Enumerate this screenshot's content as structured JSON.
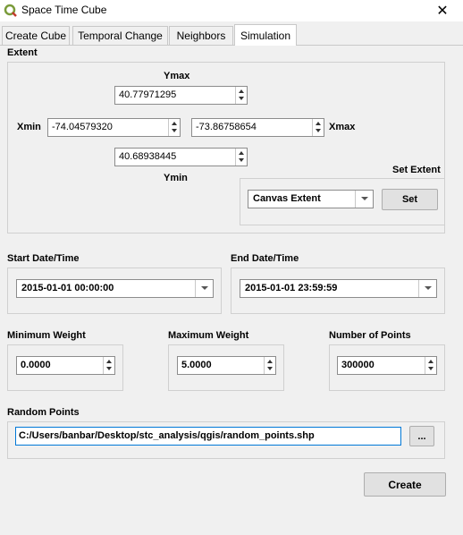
{
  "window": {
    "title": "Space Time Cube",
    "close_glyph": "✕"
  },
  "tabs": [
    {
      "label": "Create Cube"
    },
    {
      "label": "Temporal Change"
    },
    {
      "label": "Neighbors"
    },
    {
      "label": "Simulation"
    }
  ],
  "extent": {
    "label": "Extent",
    "ymax_label": "Ymax",
    "ymax_value": "40.77971295",
    "xmin_label": "Xmin",
    "xmin_value": "-74.04579320",
    "xmax_label": "Xmax",
    "xmax_value": "-73.86758654",
    "ymin_label": "Ymin",
    "ymin_value": "40.68938445",
    "set_extent_label": "Set Extent",
    "canvas_combo_value": "Canvas Extent",
    "set_button": "Set"
  },
  "dates": {
    "start_label": "Start Date/Time",
    "start_value": "2015-01-01 00:00:00",
    "end_label": "End Date/Time",
    "end_value": "2015-01-01 23:59:59"
  },
  "weights": {
    "min_label": "Minimum Weight",
    "min_value": "0.0000",
    "max_label": "Maximum Weight",
    "max_value": "5.0000",
    "points_label": "Number of Points",
    "points_value": "300000"
  },
  "random_points": {
    "label": "Random Points",
    "path": "C:/Users/banbar/Desktop/stc_analysis/qgis/random_points.shp",
    "browse": "..."
  },
  "create_button": "Create"
}
